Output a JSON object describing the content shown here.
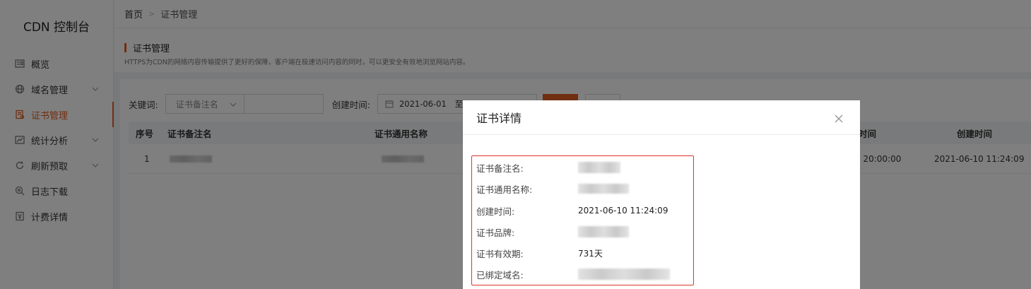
{
  "app": {
    "title": "CDN 控制台"
  },
  "sidebar": {
    "items": [
      {
        "label": "概览",
        "icon": "overview-icon",
        "expandable": false,
        "active": false
      },
      {
        "label": "域名管理",
        "icon": "globe-icon",
        "expandable": true,
        "active": false
      },
      {
        "label": "证书管理",
        "icon": "certificate-icon",
        "expandable": false,
        "active": true
      },
      {
        "label": "统计分析",
        "icon": "chart-icon",
        "expandable": true,
        "active": false
      },
      {
        "label": "刷新预取",
        "icon": "refresh-icon",
        "expandable": true,
        "active": false
      },
      {
        "label": "日志下载",
        "icon": "log-search-icon",
        "expandable": false,
        "active": false
      },
      {
        "label": "计费详情",
        "icon": "billing-icon",
        "expandable": false,
        "active": false
      }
    ]
  },
  "breadcrumb": {
    "home": "首页",
    "current": "证书管理"
  },
  "section": {
    "title": "证书管理",
    "description": "HTTPS为CDN的网络内容传输提供了更好的保障，客户端在极速访问内容的同时，可以更安全有效地浏览网站内容。"
  },
  "filter": {
    "keyword_label": "关键词:",
    "select_value": "证书备注名",
    "created_label": "创建时间:",
    "date_start": "2021-06-01",
    "date_to": "至"
  },
  "table": {
    "headers": {
      "index": "序号",
      "remark_name": "证书备注名",
      "common_name": "证书通用名称",
      "expire_time": "时间",
      "created_time": "创建时间"
    },
    "rows": [
      {
        "index": "1",
        "expire_partial": "2 20:00:00",
        "created": "2021-06-10 11:24:09"
      }
    ]
  },
  "modal": {
    "title": "证书详情",
    "fields": [
      {
        "label": "证书备注名:",
        "value": ""
      },
      {
        "label": "证书通用名称:",
        "value": ""
      },
      {
        "label": "创建时间:",
        "value": "2021-06-10 11:24:09"
      },
      {
        "label": "证书品牌:",
        "value": ""
      },
      {
        "label": "证书有效期:",
        "value": "731天"
      },
      {
        "label": "已绑定域名:",
        "value": ""
      }
    ]
  },
  "colors": {
    "accent": "#e35d20",
    "highlight_border": "#e0332b"
  }
}
